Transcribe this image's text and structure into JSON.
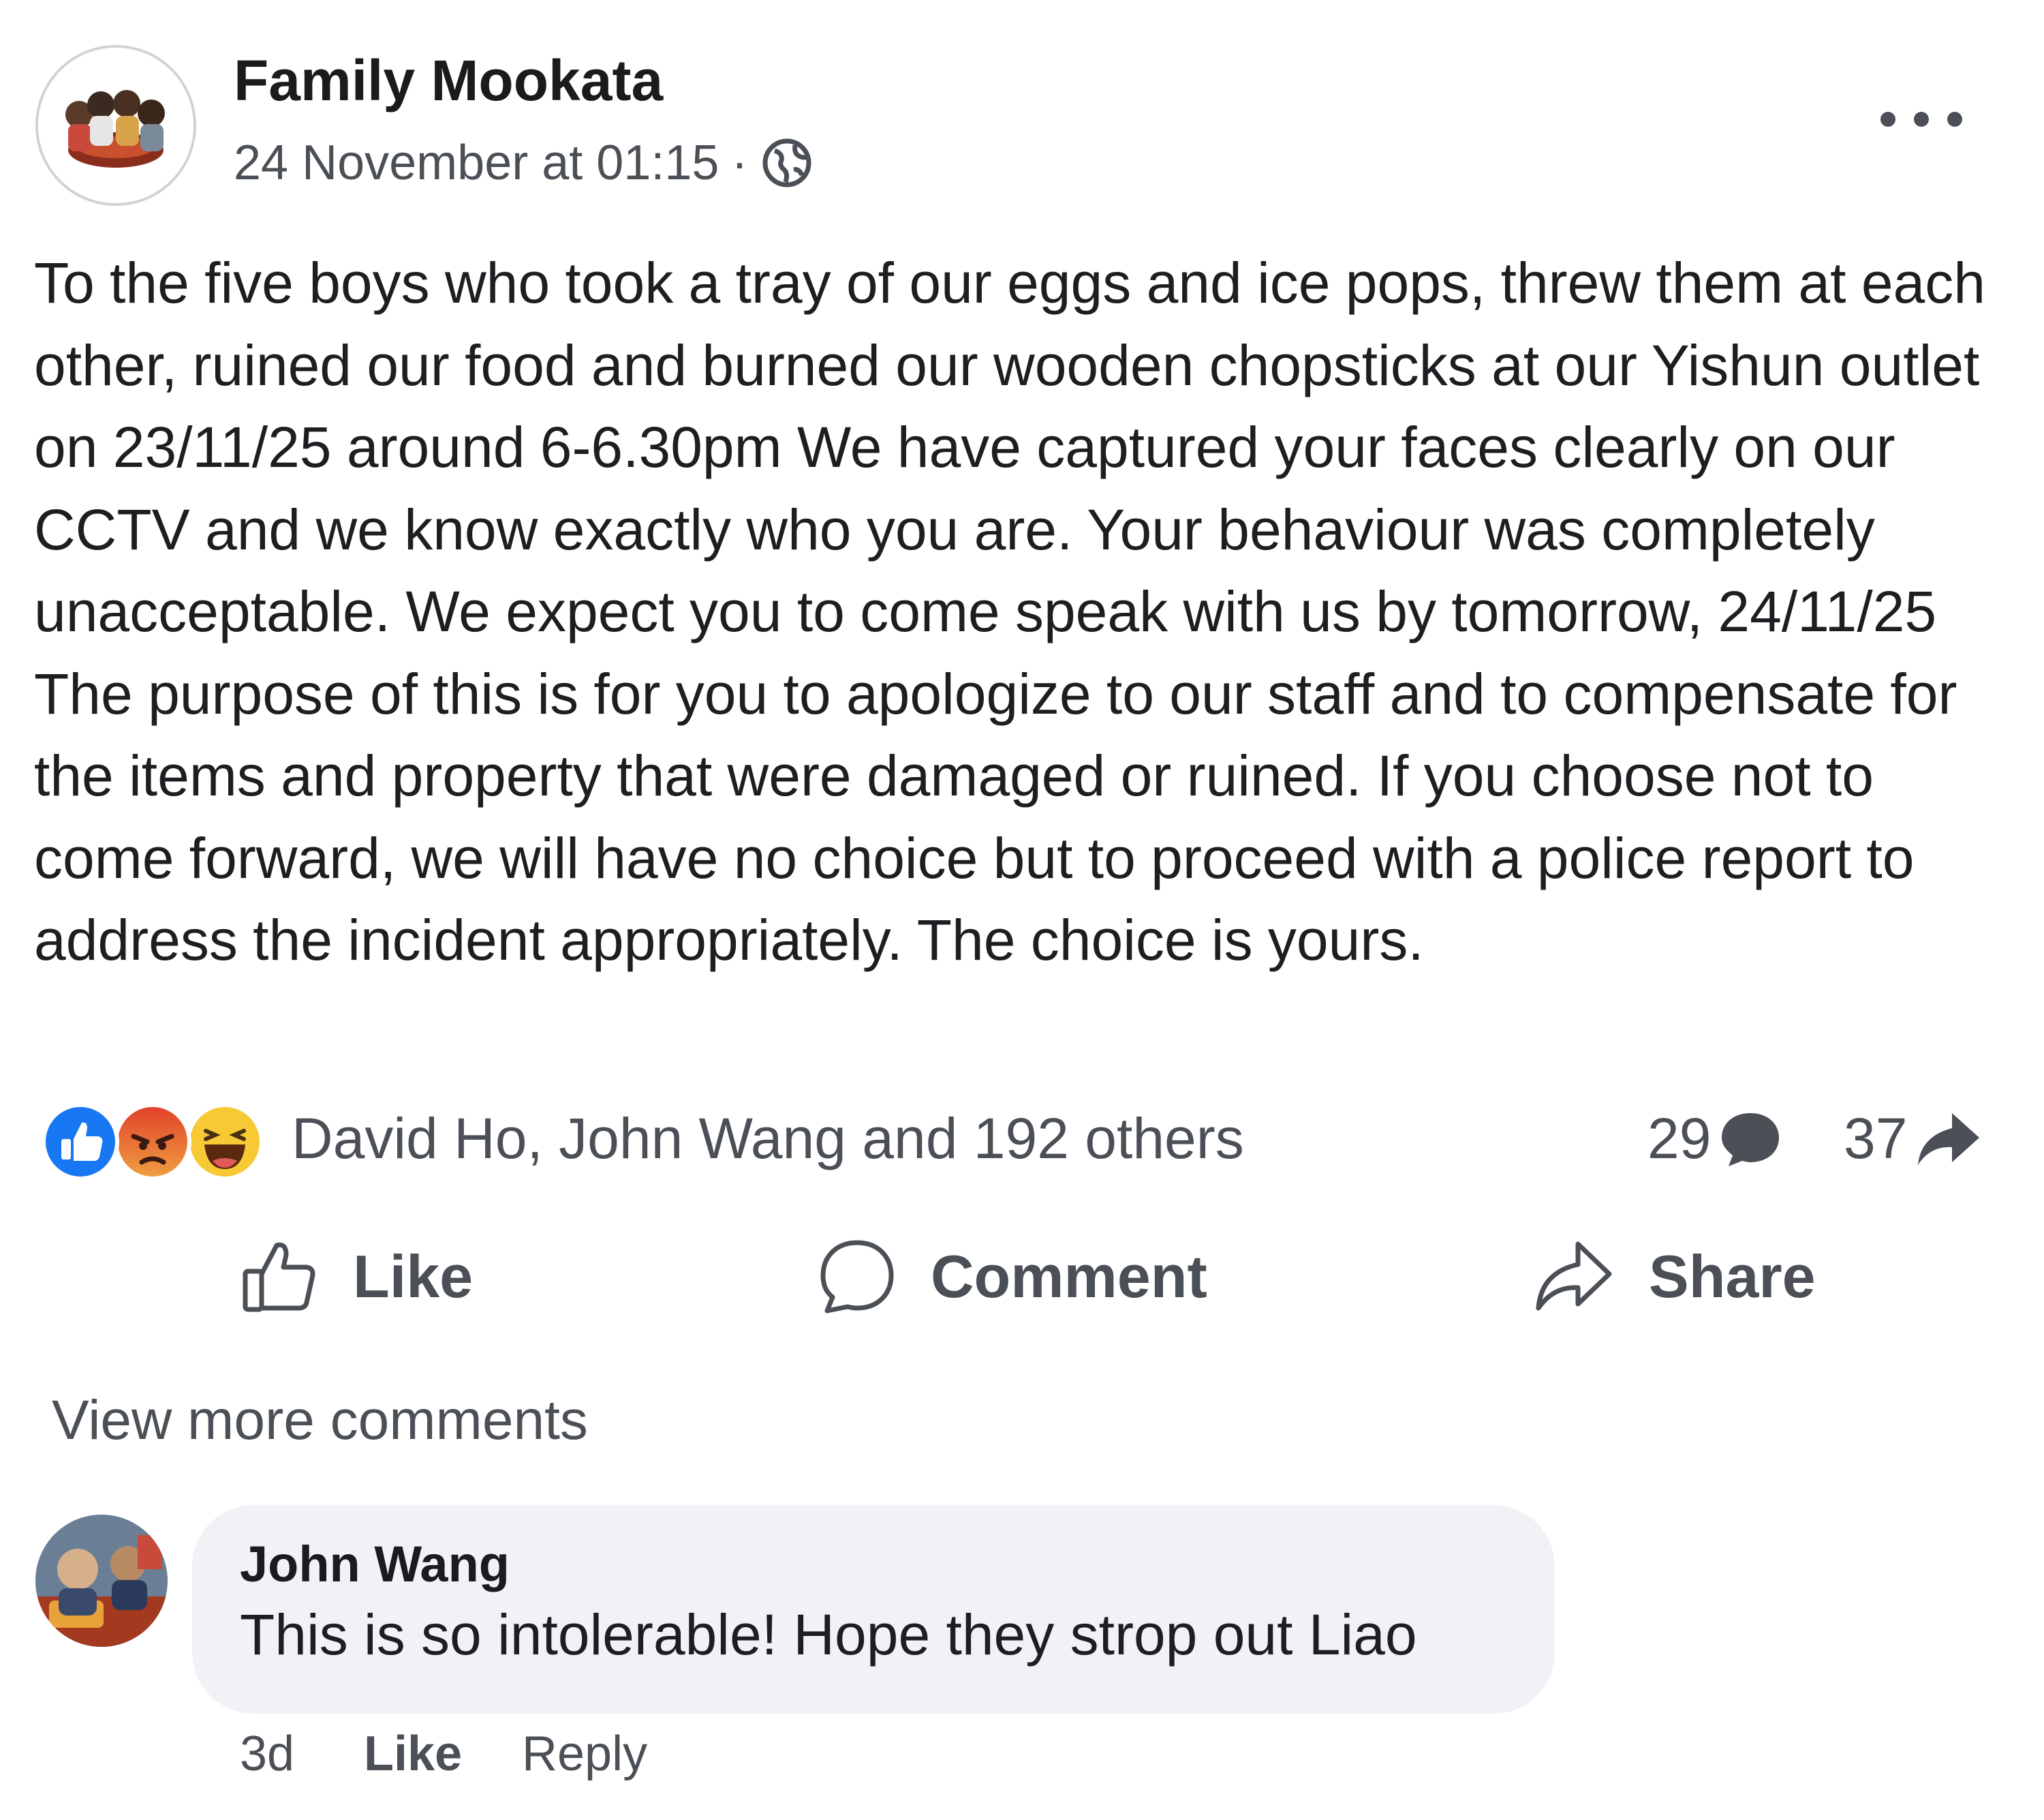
{
  "post": {
    "author": "Family Mookata",
    "timestamp": "24 November at 01:15",
    "separator": "·",
    "privacy_icon": "globe-icon",
    "more_icon": "more-options-icon",
    "body": "To the five boys who took a tray of our eggs and ice pops, threw them at each other, ruined our food and burned our wooden chopsticks at our Yishun outlet on 23/11/25 around 6-6.30pm We have captured your faces clearly on our CCTV and we know exactly who you are. Your behaviour was completely unacceptable. We expect you to come speak with us by tomorrow, 24/11/25 The purpose of this is for you to apologize to our staff and to compensate for the items and property that were damaged or ruined. If you choose not to come forward, we will have no choice but to proceed with a police report to address the incident appropriately. The choice is yours."
  },
  "reactions": {
    "icons": [
      "like-reaction-icon",
      "angry-reaction-icon",
      "haha-reaction-icon"
    ],
    "summary": "David Ho, John Wang and 192 others",
    "comments_count": "29",
    "shares_count": "37"
  },
  "actions": {
    "like": "Like",
    "comment": "Comment",
    "share": "Share"
  },
  "comments": {
    "view_more": "View more comments",
    "items": [
      {
        "author": "John Wang",
        "text": "This is so intolerable! Hope they strop out Liao",
        "age": "3d",
        "like": "Like",
        "reply": "Reply"
      }
    ]
  },
  "colors": {
    "text": "#1c1e21",
    "secondary_text": "#4b4f56",
    "bubble": "#f0f2f5",
    "like_blue": "#1877f2",
    "angry_red": "#e9512f",
    "haha_yellow": "#f7c934"
  }
}
